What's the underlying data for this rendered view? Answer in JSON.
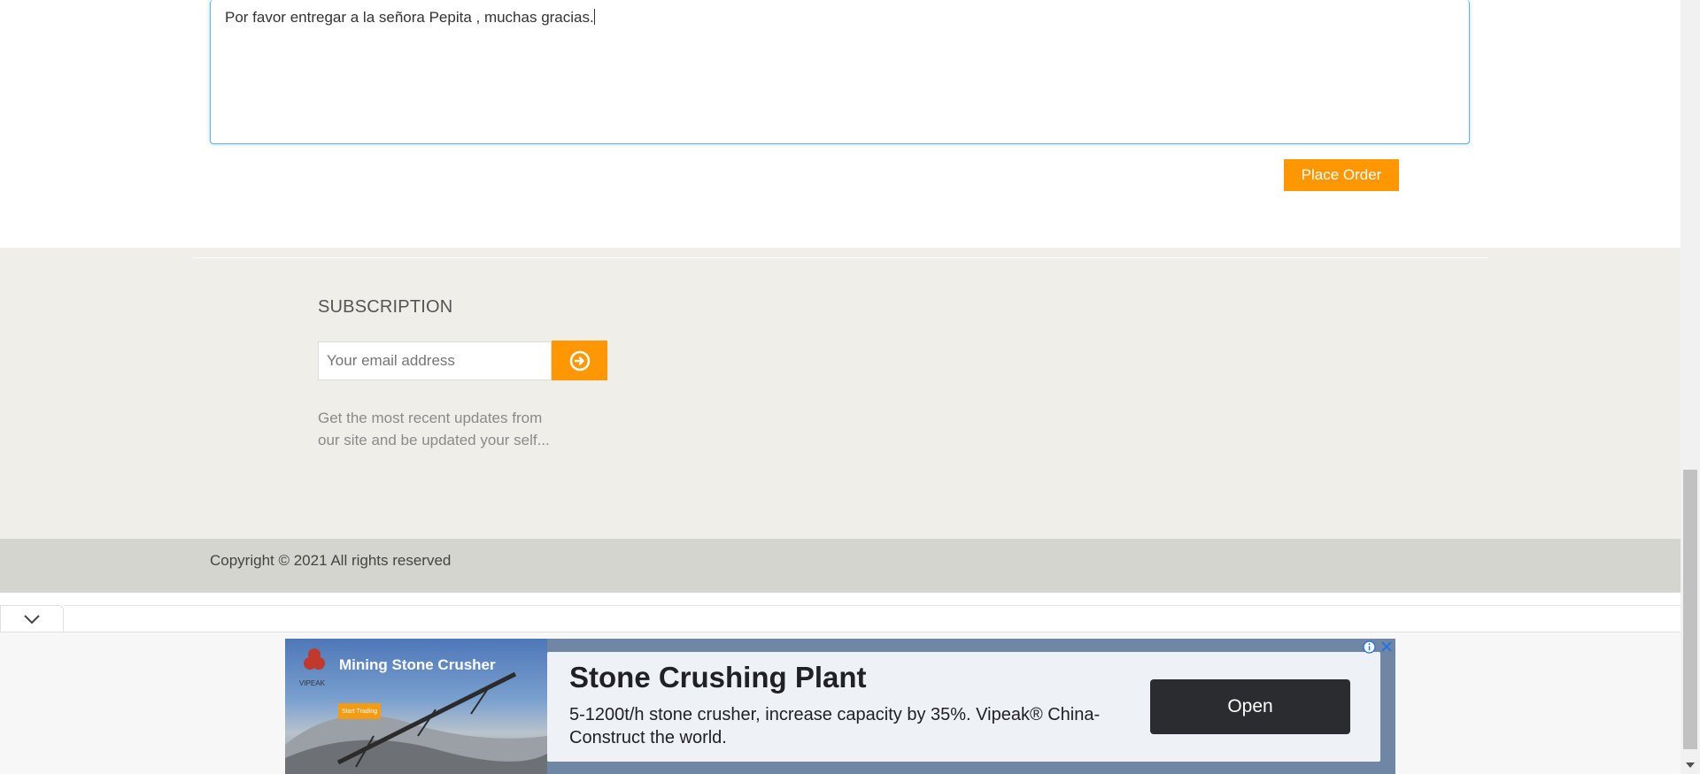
{
  "order": {
    "notes_value": "Por favor entregar a la señora Pepita , muchas gracias.",
    "place_order_label": "Place Order"
  },
  "footer": {
    "subscription_title": "SUBSCRIPTION",
    "email_placeholder": "Your email address",
    "subscribe_icon": "arrow-circle-right-icon",
    "description_line1": "Get the most recent updates from",
    "description_line2": "our site and be updated your self...",
    "copyright": "Copyright © 2021 All rights reserved"
  },
  "ad": {
    "image_title": "Mining Stone Crusher",
    "image_brand": "VIPEAK",
    "image_button": "Start Trading",
    "headline": "Stone Crushing Plant",
    "body": "5-1200t/h stone crusher, increase capacity by 35%. Vipeak® China-Construct the world.",
    "open_label": "Open",
    "info_icon": "info-icon",
    "close_icon": "close-icon"
  },
  "colors": {
    "accent": "#ff9702",
    "footer_bg": "#efeee8",
    "copyright_bg": "#d5d5d0",
    "ad_button": "#2b2c2f"
  }
}
